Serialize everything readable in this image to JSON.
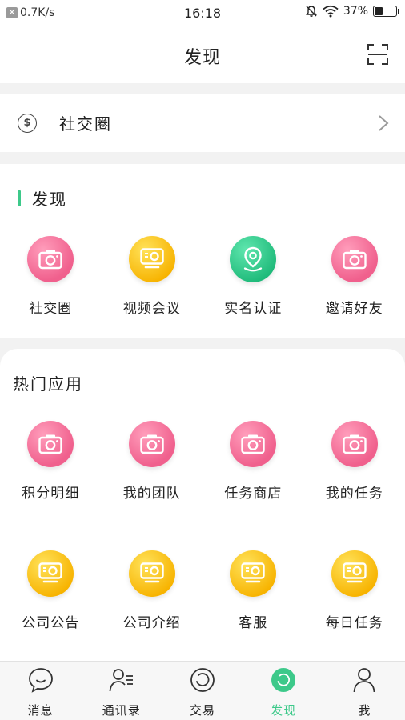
{
  "status_bar": {
    "network_speed": "0.7K/s",
    "time": "16:18",
    "battery_text": "37%",
    "battery_level": 0.37
  },
  "header": {
    "title": "发现",
    "scan_icon": "scan-icon"
  },
  "social_row": {
    "label": "社交圈",
    "icon": "coin-icon",
    "coin_symbol": "$"
  },
  "discover": {
    "title": "发现",
    "accent_color": "#3dc98a",
    "items": [
      {
        "label": "社交圈",
        "icon": "camera-icon",
        "color": "pink"
      },
      {
        "label": "视频会议",
        "icon": "projector-icon",
        "color": "yellow"
      },
      {
        "label": "实名认证",
        "icon": "location-pin-icon",
        "color": "green"
      },
      {
        "label": "邀请好友",
        "icon": "camera-icon",
        "color": "pink"
      }
    ]
  },
  "hot_apps": {
    "title": "热门应用",
    "items": [
      {
        "label": "积分明细",
        "icon": "camera-icon",
        "color": "pink"
      },
      {
        "label": "我的团队",
        "icon": "camera-icon",
        "color": "pink"
      },
      {
        "label": "任务商店",
        "icon": "camera-icon",
        "color": "pink"
      },
      {
        "label": "我的任务",
        "icon": "camera-icon",
        "color": "pink"
      },
      {
        "label": "公司公告",
        "icon": "projector-icon",
        "color": "yellow"
      },
      {
        "label": "公司介绍",
        "icon": "projector-icon",
        "color": "yellow"
      },
      {
        "label": "客服",
        "icon": "projector-icon",
        "color": "yellow"
      },
      {
        "label": "每日任务",
        "icon": "projector-icon",
        "color": "yellow"
      }
    ]
  },
  "bottom_nav": {
    "active_color": "#3dc98a",
    "items": [
      {
        "label": "消息",
        "icon": "chat-bubble-icon"
      },
      {
        "label": "通讯录",
        "icon": "contacts-icon"
      },
      {
        "label": "交易",
        "icon": "exchange-circle-icon"
      },
      {
        "label": "发现",
        "icon": "discover-icon",
        "active": true
      },
      {
        "label": "我",
        "icon": "profile-icon"
      }
    ]
  }
}
